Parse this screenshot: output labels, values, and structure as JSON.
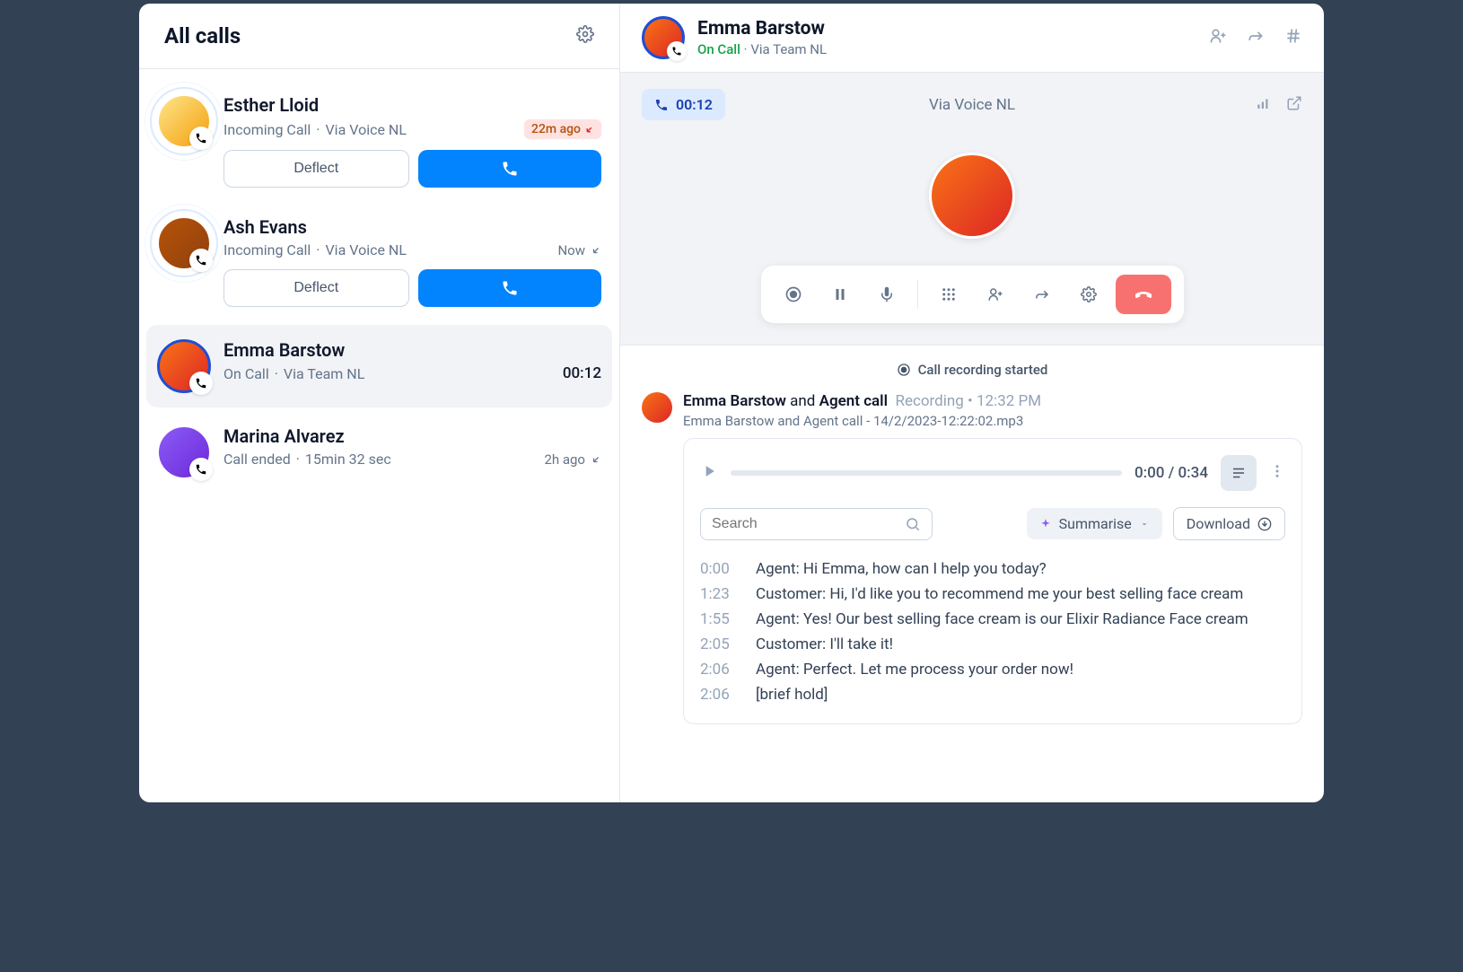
{
  "sidebar": {
    "title": "All calls"
  },
  "calls": [
    {
      "name": "Esther Lloid",
      "status": "Incoming Call",
      "via": "Via Voice NL",
      "time_label": "22m ago",
      "deflect_label": "Deflect"
    },
    {
      "name": "Ash Evans",
      "status": "Incoming Call",
      "via": "Via Voice NL",
      "time_label": "Now",
      "deflect_label": "Deflect"
    },
    {
      "name": "Emma Barstow",
      "status": "On Call",
      "via": "Via Team NL",
      "duration": "00:12"
    },
    {
      "name": "Marina Alvarez",
      "status": "Call ended",
      "duration_text": "15min 32 sec",
      "time_label": "2h ago"
    }
  ],
  "main": {
    "name": "Emma Barstow",
    "status": "On Call",
    "via": "Via Team NL",
    "timer": "00:12",
    "stage_via": "Via Voice NL"
  },
  "recording": {
    "started_label": "Call recording started",
    "title_bold": "Emma Barstow",
    "title_mid": " and ",
    "title_bold2": "Agent call",
    "title_muted": "Recording",
    "title_time": "12:32 PM",
    "filename": "Emma Barstow and Agent call - 14/2/2023-12:22:02.mp3",
    "play_time": "0:00 / 0:34",
    "search_placeholder": "Search",
    "summarise_label": "Summarise",
    "download_label": "Download",
    "transcript": [
      {
        "t": "0:00",
        "text": "Agent: Hi Emma, how can I help you today?"
      },
      {
        "t": "1:23",
        "text": "Customer: Hi, I'd like you to recommend me your best selling face cream"
      },
      {
        "t": "1:55",
        "text": "Agent: Yes! Our best selling face cream is our Elixir Radiance Face cream"
      },
      {
        "t": "2:05",
        "text": "Customer: I'll take it!"
      },
      {
        "t": "2:06",
        "text": "Agent: Perfect. Let me process your order now!"
      },
      {
        "t": "2:06",
        "text": "[brief hold]"
      }
    ]
  }
}
